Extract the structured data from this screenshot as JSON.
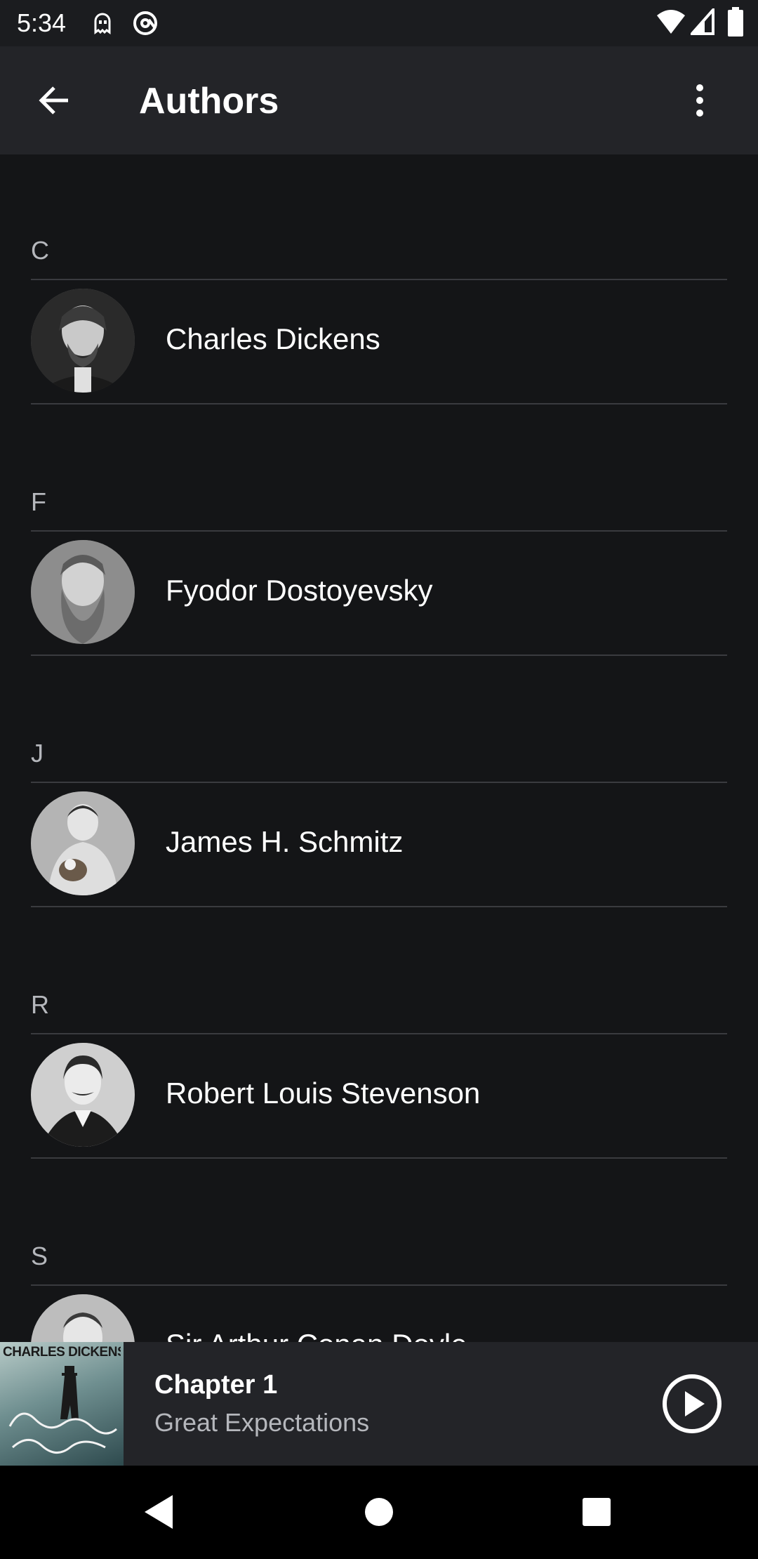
{
  "status_bar": {
    "time": "5:34",
    "icons": [
      "ghost-icon",
      "at-sign-icon",
      "wifi-icon",
      "signal-icon",
      "battery-icon"
    ]
  },
  "app_bar": {
    "title": "Authors",
    "back_icon": "arrow-back-icon",
    "menu_icon": "more-vert-icon"
  },
  "sections": [
    {
      "letter": "C",
      "authors": [
        {
          "name": "Charles Dickens"
        }
      ]
    },
    {
      "letter": "F",
      "authors": [
        {
          "name": "Fyodor Dostoyevsky"
        }
      ]
    },
    {
      "letter": "J",
      "authors": [
        {
          "name": "James H. Schmitz"
        }
      ]
    },
    {
      "letter": "R",
      "authors": [
        {
          "name": "Robert Louis Stevenson"
        }
      ]
    },
    {
      "letter": "S",
      "authors": [
        {
          "name": "Sir Arthur Conan Doyle"
        }
      ]
    }
  ],
  "mini_player": {
    "cover_author": "CHARLES DICKENS",
    "chapter": "Chapter 1",
    "book": "Great Expectations",
    "play_icon": "play-circle-icon"
  },
  "nav_bar": {
    "icons": [
      "back-triangle-icon",
      "home-circle-icon",
      "recents-square-icon"
    ]
  },
  "colors": {
    "background": "#141517",
    "app_bar": "#232428",
    "divider": "#3a3b3f",
    "secondary_text": "#b5b7bc"
  }
}
